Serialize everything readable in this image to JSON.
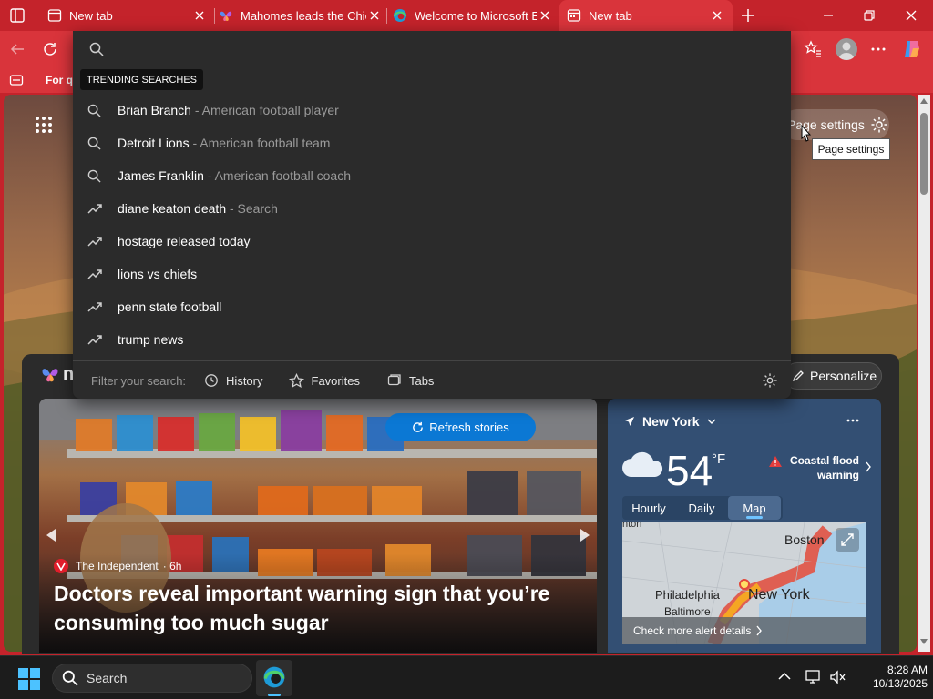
{
  "tabs": [
    {
      "title": "New tab",
      "active": false
    },
    {
      "title": "Mahomes leads the Chie",
      "active": false
    },
    {
      "title": "Welcome to Microsoft E",
      "active": false
    },
    {
      "title": "New tab",
      "active": true
    }
  ],
  "toolbar": {
    "favbar_item": "For qu"
  },
  "search": {
    "trending_header": "TRENDING SEARCHES",
    "suggestions": [
      {
        "term": "Brian Branch",
        "desc": " - American football player",
        "icon": "search-icon"
      },
      {
        "term": "Detroit Lions",
        "desc": " - American football team",
        "icon": "search-icon"
      },
      {
        "term": "James Franklin",
        "desc": " - American football coach",
        "icon": "search-icon"
      },
      {
        "term": "diane keaton death",
        "desc": " - Search",
        "icon": "trending-icon"
      },
      {
        "term": "hostage released today",
        "desc": "",
        "icon": "trending-icon"
      },
      {
        "term": "lions vs chiefs",
        "desc": "",
        "icon": "trending-icon"
      },
      {
        "term": "penn state football",
        "desc": "",
        "icon": "trending-icon"
      },
      {
        "term": "trump news",
        "desc": "",
        "icon": "trending-icon"
      }
    ],
    "filter_label": "Filter your search:",
    "filters": {
      "history": "History",
      "favorites": "Favorites",
      "tabs": "Tabs"
    }
  },
  "page": {
    "page_settings": "Page settings",
    "page_settings_tooltip": "Page settings",
    "personalize": "Personalize",
    "refresh_stories": "Refresh stories",
    "news_logo_letter": "n"
  },
  "hero": {
    "source": "The Independent",
    "age": "· 6h",
    "headline": "Doctors reveal important warning sign that you’re consuming too much sugar"
  },
  "weather": {
    "location": "New York",
    "temp": "54",
    "unit": "°F",
    "alert": "Coastal flood warning",
    "tabs": [
      "Hourly",
      "Daily",
      "Map"
    ],
    "active_tab": "Map",
    "map_labels": {
      "boston": "Boston",
      "philadelphia": "Philadelphia",
      "baltimore": "Baltimore",
      "new_york": "New York",
      "top_left": "hton"
    },
    "alert_link": "Check more alert details"
  },
  "taskbar": {
    "search_label": "Search",
    "time": "8:28 AM",
    "date": "10/13/2025"
  },
  "colors": {
    "accent": "#c4232b",
    "refresh_button": "#0b78d4"
  }
}
